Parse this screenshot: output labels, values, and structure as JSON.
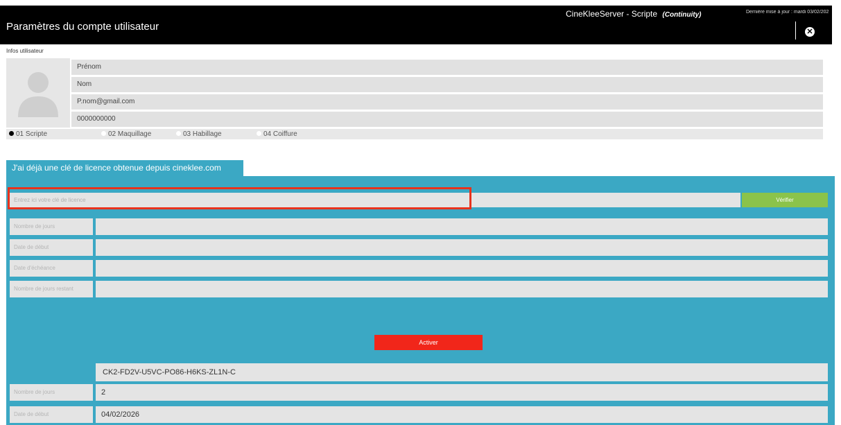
{
  "header": {
    "window_title": "Paramètres du compte utilisateur",
    "app_name": "CineKleeServer - Scripte",
    "app_mode": "(Continuity)",
    "last_update": "Dernière mise à jour : mardi 03/02/202",
    "close_icon": "close-circle-icon"
  },
  "user_info": {
    "section_label": "Infos utilisateur",
    "avatar_icon": "user-silhouette-icon",
    "first_name": "Prénom",
    "last_name": "Nom",
    "email": "P.nom@gmail.com",
    "phone": "0000000000"
  },
  "roles": [
    {
      "label": "01  Scripte",
      "selected": true
    },
    {
      "label": "02  Maquillage",
      "selected": false
    },
    {
      "label": "03  Habillage",
      "selected": false
    },
    {
      "label": "04  Coiffure",
      "selected": false
    }
  ],
  "license": {
    "tab_label": "J'ai déjà une clé de licence obtenue depuis cineklee.com",
    "input_placeholder": "Entrez ici votre clé de licence",
    "verify_label": "Vérifier",
    "fields": [
      {
        "label": "Nombre de jours",
        "value": ""
      },
      {
        "label": "Date de début",
        "value": ""
      },
      {
        "label": "Date d'échéance",
        "value": ""
      },
      {
        "label": "Nombre de jours restant",
        "value": ""
      }
    ],
    "activate_label": "Activer",
    "license_key": "CK2-FD2V-U5VC-PO86-H6KS-ZL1N-C",
    "active_fields": [
      {
        "label": "Nombre de jours",
        "value": "2"
      },
      {
        "label": "Date de début",
        "value": "04/02/2026"
      }
    ]
  },
  "colors": {
    "header_bg": "#000000",
    "panel_bg": "#3ba8c4",
    "verify_button": "#8bc34a",
    "activate_button": "#f1261a",
    "highlight": "#e8321c"
  }
}
